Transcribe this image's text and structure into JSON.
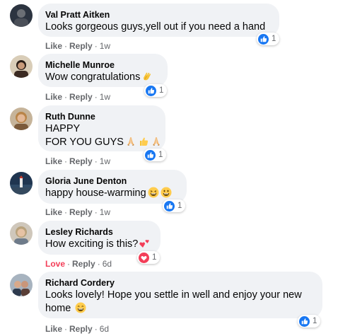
{
  "comments": [
    {
      "author": "Val Pratt Aitken",
      "lines": [
        "Looks gorgeous guys,yell out if you need a hand"
      ],
      "reaction_icon": "like-icon",
      "reaction_count": "1",
      "action": "Like",
      "reply": "Reply",
      "time": "1w"
    },
    {
      "author": "Michelle Munroe",
      "lines": [
        "Wow congratulations"
      ],
      "emojis": [
        "clapping-hands-emoji"
      ],
      "reaction_icon": "like-icon",
      "reaction_count": "1",
      "action": "Like",
      "reply": "Reply",
      "time": "1w"
    },
    {
      "author": "Ruth Dunne",
      "lines": [
        "HAPPY",
        "FOR YOU GUYS"
      ],
      "emojis": [
        "folded-hands-emoji",
        "thumbs-up-emoji",
        "folded-hands-emoji"
      ],
      "reaction_icon": "like-icon",
      "reaction_count": "1",
      "action": "Like",
      "reply": "Reply",
      "time": "1w"
    },
    {
      "author": "Gloria June Denton",
      "lines": [
        "happy house-warming"
      ],
      "emojis": [
        "grinning-squinting-face-emoji",
        "grinning-face-emoji"
      ],
      "reaction_icon": "like-icon",
      "reaction_count": "1",
      "action": "Like",
      "reply": "Reply",
      "time": "1w"
    },
    {
      "author": "Lesley Richards",
      "lines": [
        "How exciting is this?"
      ],
      "emojis": [
        "two-hearts-emoji"
      ],
      "reaction_icon": "love-icon",
      "reaction_count": "1",
      "action": "Love",
      "reply": "Reply",
      "time": "6d"
    },
    {
      "author": "Richard Cordery",
      "lines": [
        "Looks lovely! Hope you settle in well and enjoy your new",
        "home"
      ],
      "emojis": [
        "beaming-face-emoji"
      ],
      "reaction_icon": "like-icon",
      "reaction_count": "1",
      "action": "Like",
      "reply": "Reply",
      "time": "6d"
    }
  ],
  "colors": {
    "bubble": "#f0f2f5",
    "like_blue": "#1877f2",
    "love_red": "#f33e58",
    "meta_gray": "#65676b"
  }
}
